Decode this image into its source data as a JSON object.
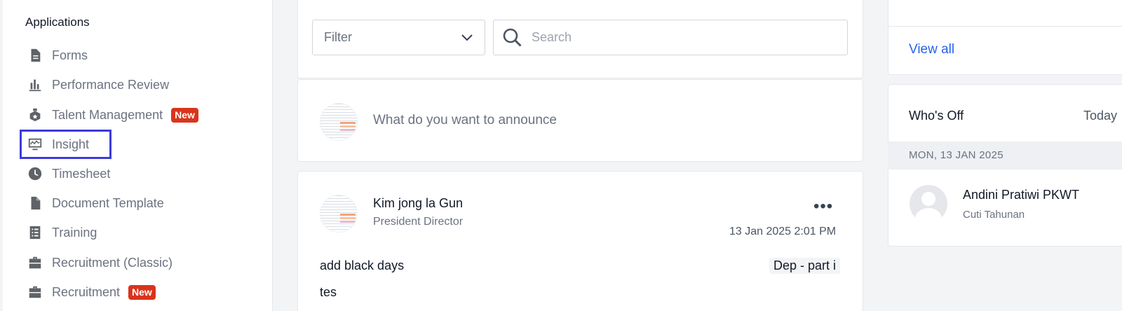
{
  "sidebar": {
    "title": "Applications",
    "items": [
      {
        "label": "Forms",
        "icon": "file-icon"
      },
      {
        "label": "Performance Review",
        "icon": "bar-chart-icon"
      },
      {
        "label": "Talent Management",
        "icon": "badge-icon",
        "badge": "New"
      },
      {
        "label": "Insight",
        "icon": "insight-monitor-icon",
        "selected": true
      },
      {
        "label": "Timesheet",
        "icon": "clock-icon"
      },
      {
        "label": "Document Template",
        "icon": "document-icon"
      },
      {
        "label": "Training",
        "icon": "list-icon"
      },
      {
        "label": "Recruitment (Classic)",
        "icon": "briefcase-icon"
      },
      {
        "label": "Recruitment",
        "icon": "briefcase-icon",
        "badge": "New"
      }
    ]
  },
  "feed": {
    "filter_label": "Filter",
    "search_placeholder": "Search",
    "announce_placeholder": "What do you want to announce",
    "post": {
      "author": "Kim jong la Gun",
      "role": "President Director",
      "more": "•••",
      "date": "13 Jan 2025 2:01 PM",
      "title": "add black days",
      "tag": "Dep - part i",
      "body": "tes"
    }
  },
  "right": {
    "view_all": "View all",
    "whos_off_title": "Who's Off",
    "whos_off_period": "Today",
    "date_header": "MON, 13 JAN 2025",
    "person_name": "Andini Pratiwi PKWT",
    "person_status": "Cuti Tahunan"
  },
  "colors": {
    "accent_link": "#2563eb",
    "badge_new": "#d9341c",
    "selection_outline": "#3b3bdc"
  }
}
